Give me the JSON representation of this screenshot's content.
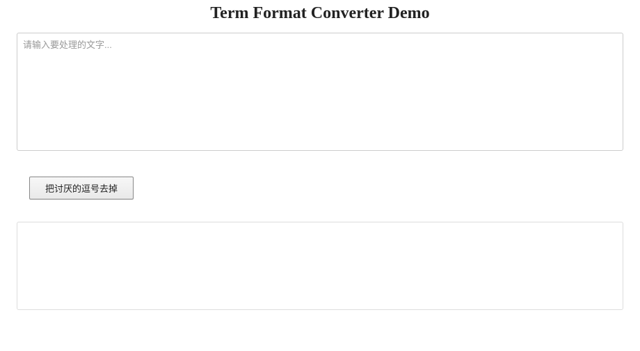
{
  "header": {
    "title": "Term Format Converter Demo"
  },
  "input": {
    "value": "",
    "placeholder": "请输入要处理的文字..."
  },
  "actions": {
    "convert_label": "把讨厌的逗号去掉"
  },
  "output": {
    "value": ""
  }
}
